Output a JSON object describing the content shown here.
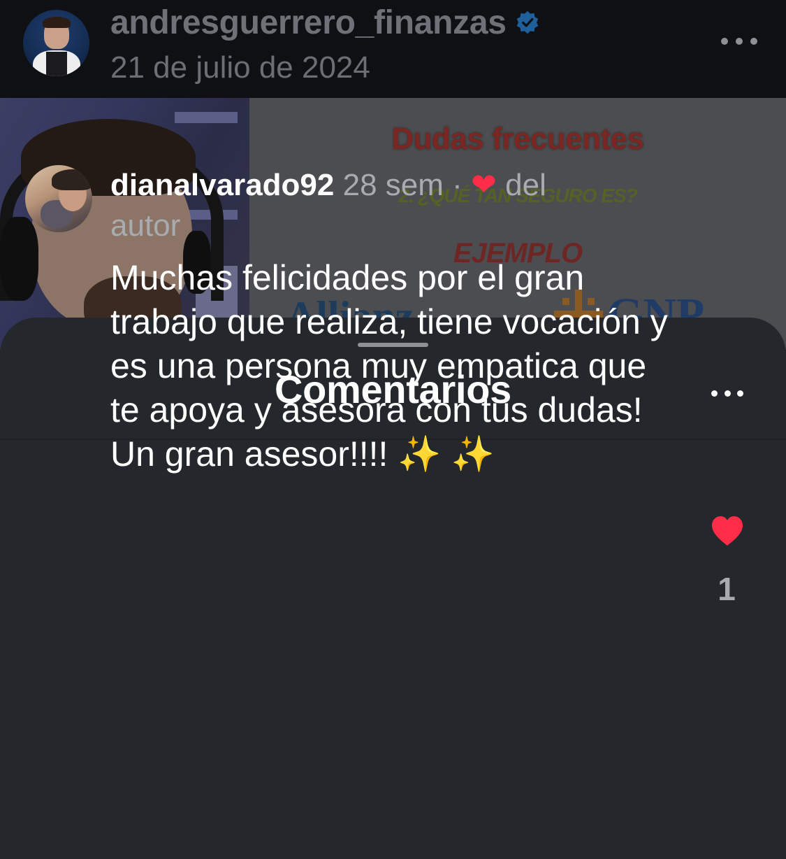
{
  "post": {
    "author_username": "andresguerrero_finanzas",
    "verified": true,
    "date": "21 de julio de 2024",
    "more_icon": "more-horizontal-icon"
  },
  "video": {
    "slide_title": "Dudas frecuentes",
    "slide_question": "2. ¿QUÉ TAN SEGURO ES?",
    "slide_example": "EJEMPLO",
    "brands": [
      "Allianz",
      "GNP"
    ]
  },
  "comments_sheet": {
    "title": "Comentarios",
    "more_icon": "more-horizontal-icon"
  },
  "comment": {
    "username": "dianalvarado92",
    "time": "28 sem",
    "separator": "·",
    "author_like_heart": "❤",
    "liked_by_author_text": "del autor",
    "text": "Muchas felicidades por el gran trabajo que realiza, tiene vocación y es una persona muy empatica que te apoya y asesora con tus dudas! Un gran asesor!!!! ✨ ✨",
    "like_icon": "heart-filled-icon",
    "like_count": "1"
  },
  "colors": {
    "sheet_background": "#24272c",
    "heart": "#ff2d48",
    "secondary_text": "#a8abb0",
    "verified_badge": "#3897f0"
  }
}
